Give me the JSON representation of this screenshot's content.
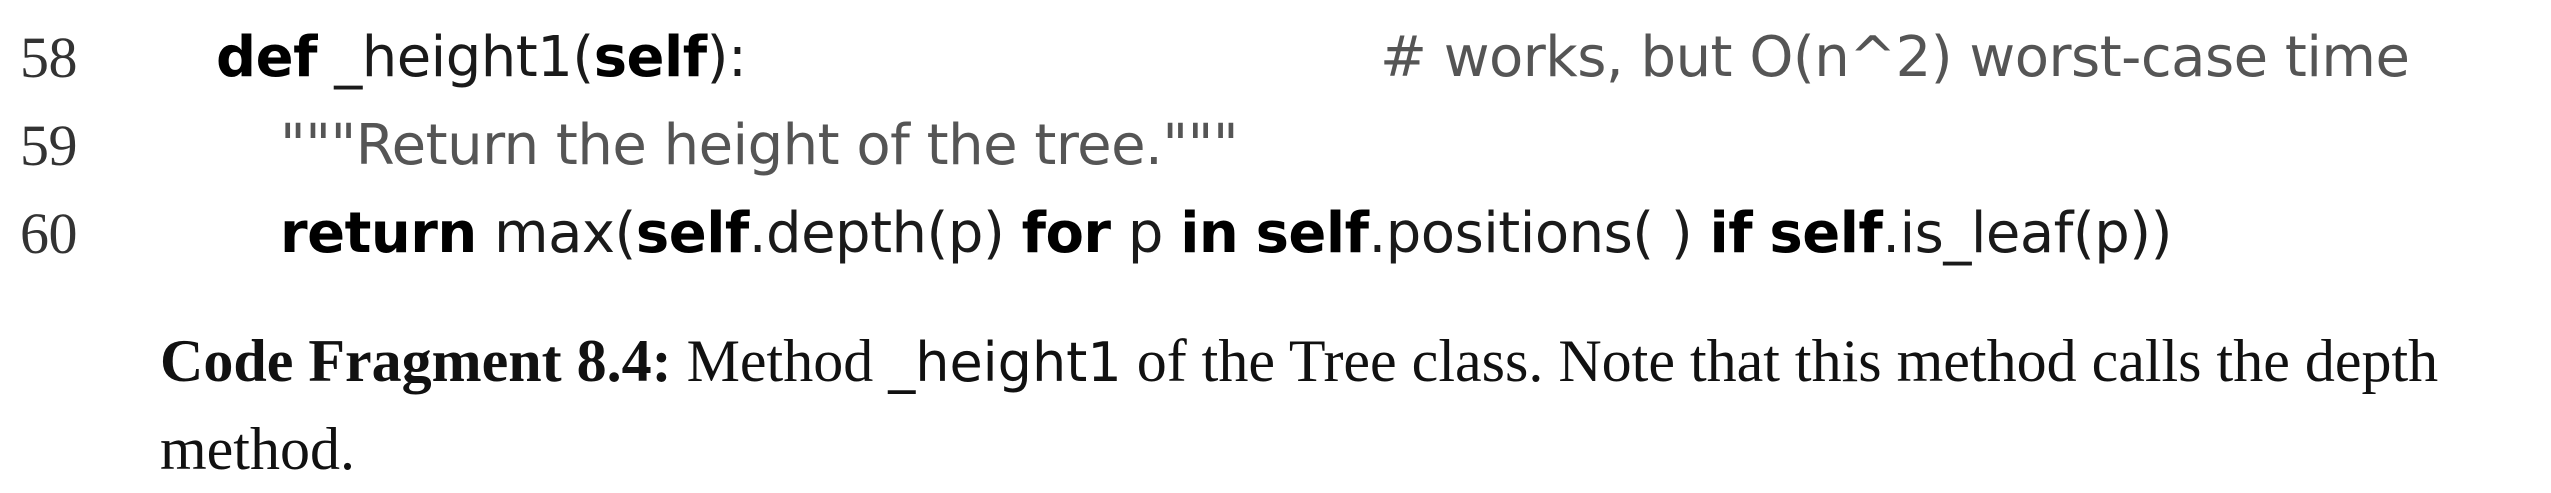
{
  "code_lines": [
    {
      "number": "58",
      "kw_def": "def",
      "name": " _height1(",
      "self": "self",
      "tail": "):",
      "comment": "# works, but O(n^2) worst-case time"
    },
    {
      "number": "59",
      "docstring": "\"\"\"Return the height of the tree.\"\"\""
    },
    {
      "number": "60",
      "kw_return": "return",
      "t1": " max(",
      "self1": "self",
      "t2": ".depth(p) ",
      "kw_for": "for",
      "t3": " p ",
      "kw_in": "in",
      "t4": " ",
      "self2": "self",
      "t5": ".positions( ) ",
      "kw_if": "if",
      "t6": " ",
      "self3": "self",
      "t7": ".is_leaf(p))"
    }
  ],
  "caption": {
    "lead": "Code Fragment 8.4:",
    "text1": " Method ",
    "method": "_height1",
    "text2": " of the Tree class. Note that this method calls the depth method."
  }
}
